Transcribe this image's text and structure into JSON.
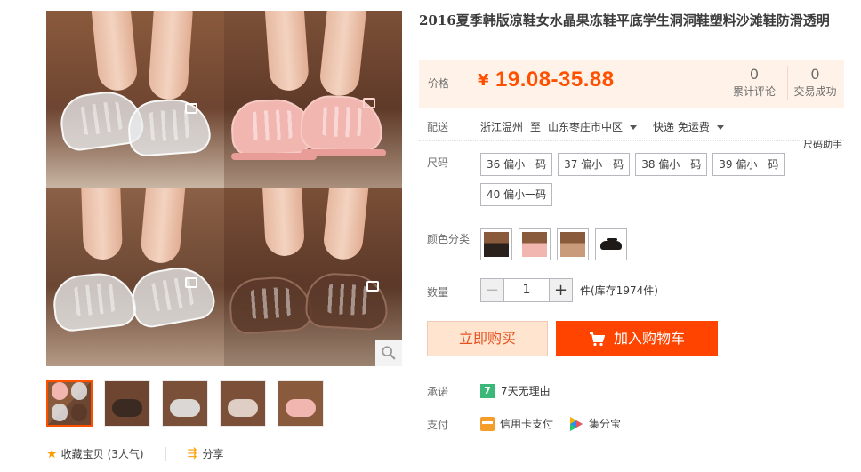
{
  "product": {
    "title": "2016夏季韩版凉鞋女水晶果冻鞋平底学生洞洞鞋塑料沙滩鞋防滑透明"
  },
  "price": {
    "label": "价格",
    "currency": "¥",
    "value": "19.08-35.88",
    "reviews_count": "0",
    "reviews_label": "累计评论",
    "sales_count": "0",
    "sales_label": "交易成功"
  },
  "shipping": {
    "label": "配送",
    "from": "浙江温州",
    "to_word": "至",
    "destination": "山东枣庄市中区",
    "method": "快递 免运费"
  },
  "size": {
    "label": "尺码",
    "helper": "尺码助手",
    "options": [
      "36 偏小一码",
      "37 偏小一码",
      "38 偏小一码",
      "39 偏小一码",
      "40 偏小一码"
    ]
  },
  "color": {
    "label": "颜色分类",
    "options": [
      "black-style",
      "pink-style",
      "brown-style",
      "black-flat"
    ]
  },
  "quantity": {
    "label": "数量",
    "value": "1",
    "stock": "件(库存1974件)"
  },
  "actions": {
    "buy_now": "立即购买",
    "add_to_cart": "加入购物车"
  },
  "promise": {
    "label": "承诺",
    "icon_text": "7",
    "text": "7天无理由"
  },
  "payment": {
    "label": "支付",
    "methods": [
      "信用卡支付",
      "集分宝"
    ]
  },
  "gallery": {
    "favorite": "收藏宝贝",
    "favorite_count": "(3人气)",
    "share": "分享"
  },
  "colors": {
    "accent": "#ff5000",
    "cart_button": "#ff4400",
    "price_bg": "#fff2e8",
    "buy_now_bg": "#ffe4d0"
  }
}
